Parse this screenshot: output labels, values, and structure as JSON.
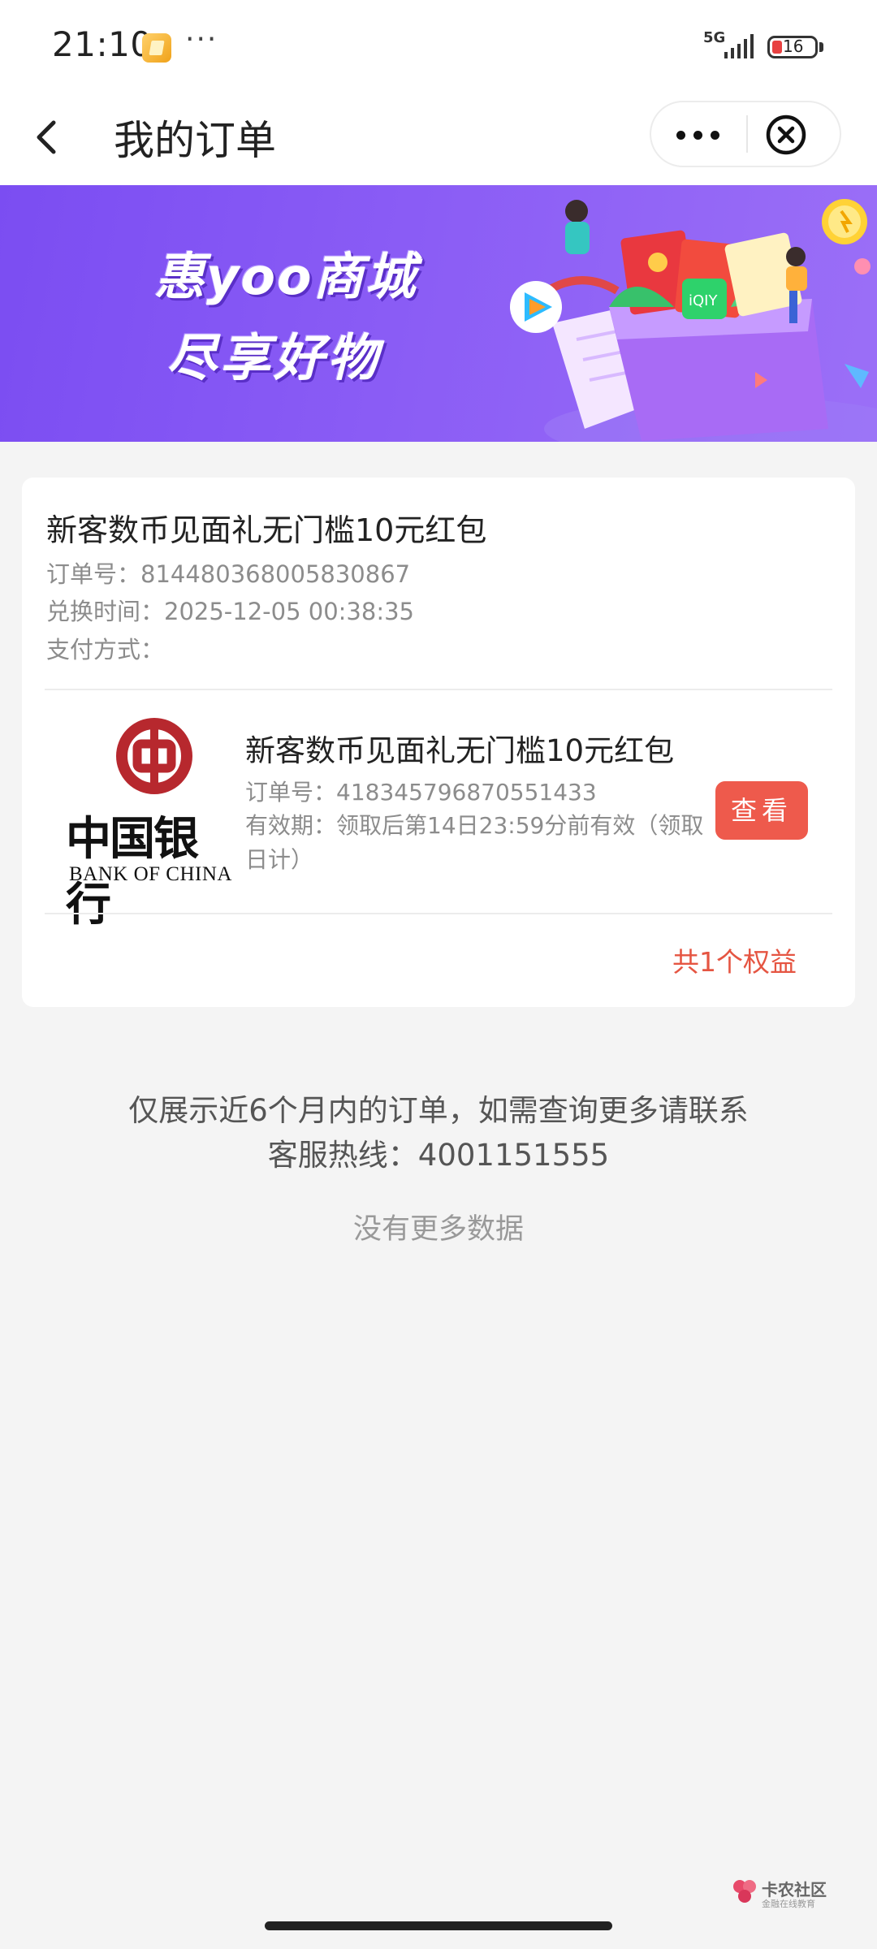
{
  "status_bar": {
    "time": "21:10",
    "dots": "···",
    "network": "5G",
    "battery": "16"
  },
  "nav": {
    "title": "我的订单",
    "icons": [
      "back-icon",
      "more-icon",
      "close-icon"
    ]
  },
  "banner": {
    "title": "惠yoo商城",
    "subtitle": "尽享好物"
  },
  "order": {
    "title": "新客数币见面礼无门槛10元红包",
    "order_no": "订单号：814480368005830867",
    "exchange_time": "兑换时间：2025-12-05 00:38:35",
    "payment": "支付方式：",
    "item": {
      "logo_cn": "中国银行",
      "logo_en": "BANK OF CHINA",
      "title": "新客数币见面礼无门槛10元红包",
      "order_no": "订单号：418345796870551433",
      "validity": "有效期：领取后第14日23:59分前有效（领取日计）",
      "view_label": "查看"
    },
    "benefit_count": "共1个权益"
  },
  "notice": {
    "line1": "仅展示近6个月内的订单，如需查询更多请联系",
    "line2": "客服热线：4001151555"
  },
  "no_more": "没有更多数据",
  "watermark": {
    "name": "卡农社区",
    "sub": "金融在线教育"
  },
  "colors": {
    "accent": "#ee5a4c",
    "benefit_text": "#e55542",
    "banner": "#8a5cf5",
    "boc_red": "#b7282e"
  }
}
